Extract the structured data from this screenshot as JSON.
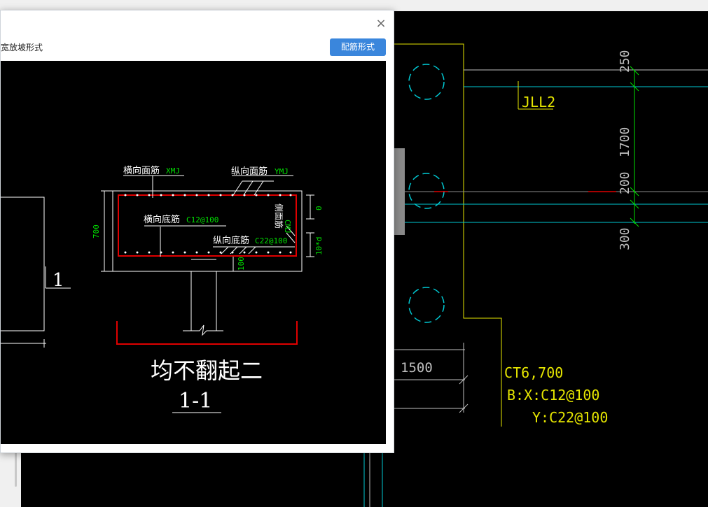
{
  "dialog": {
    "title": "宽放坡形式",
    "config_button": "配筋形式",
    "close_glyph": "×"
  },
  "preview": {
    "label_top_transverse": "横向面筋",
    "code_top_transverse": "XMJ",
    "label_top_longitudinal": "纵向面筋",
    "code_top_longitudinal": "YMJ",
    "label_bottom_transverse": "横向底筋",
    "code_bottom_transverse": "C12@100",
    "label_bottom_longitudinal": "纵向底筋",
    "code_bottom_longitudinal": "C22@100",
    "label_side": "侧面筋",
    "code_side": "CMJ",
    "dim_height": "700",
    "dim_top": "0",
    "dim_side": "10*d",
    "dim_bottom": "100",
    "section_mark": "1",
    "caption": "均不翻起二",
    "section_title": "1-1"
  },
  "cad": {
    "beam_label": "JLL2",
    "dim_250": "250",
    "dim_1700": "1700",
    "dim_200": "200",
    "dim_300": "300",
    "dim_1500": "1500",
    "cap_name": "CT6,700",
    "cap_rebar_x": "B:X:C12@100",
    "cap_rebar_y": "Y:C22@100"
  },
  "colors": {
    "cad_cyan": "#00c8d2",
    "cad_yellow": "#e6e600",
    "cad_green": "#00e000",
    "cad_red": "#e00000",
    "button_blue": "#3a86dc"
  }
}
